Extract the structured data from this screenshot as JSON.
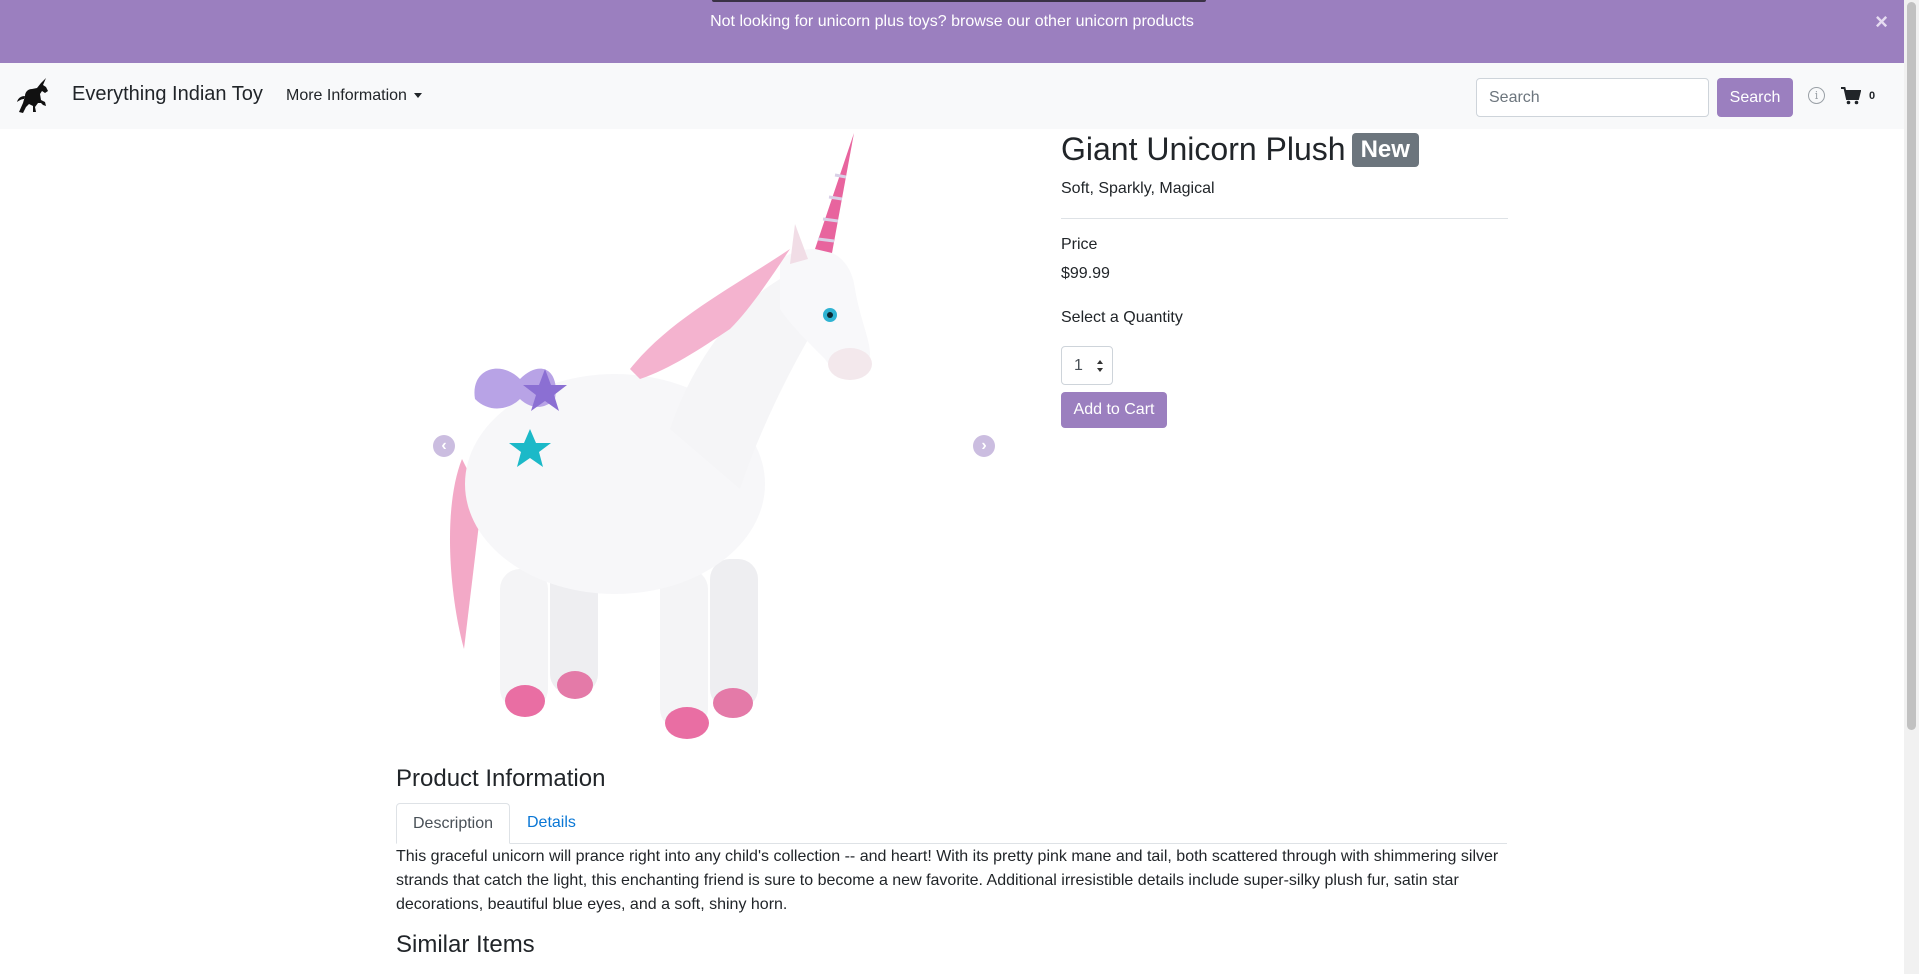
{
  "promo": {
    "text": "Not looking for unicorn plus toys? browse our other unicorn products",
    "close_label": "×"
  },
  "navbar": {
    "brand_name": "Everything Indian Toy",
    "logo_icon": "unicorn-silhouette-icon",
    "more_info_label": "More Information",
    "search_placeholder": "Search",
    "search_button_label": "Search",
    "info_icon": "info-circle-icon",
    "cart_icon": "shopping-cart-icon",
    "cart_count": "0"
  },
  "carousel": {
    "image": "giant-unicorn-plush-photo",
    "prev_label": "‹",
    "next_label": "›"
  },
  "product": {
    "title": "Giant Unicorn Plush",
    "badge": "New",
    "subtitle": "Soft, Sparkly, Magical",
    "price_label": "Price",
    "price": "$99.99",
    "quantity_label": "Select a Quantity",
    "quantity_value": "1",
    "add_to_cart_label": "Add to Cart"
  },
  "info": {
    "heading": "Product Information",
    "tabs": [
      {
        "label": "Description",
        "active": true
      },
      {
        "label": "Details",
        "active": false
      }
    ],
    "description": "This graceful unicorn will prance right into any child's collection -- and heart! With its pretty pink mane and tail, both scattered through with shimmering silver strands that catch the light, this enchanting friend is sure to become a new favorite. Additional irresistible details include super-silky plush fur, satin star decorations, beautiful blue eyes, and a soft, shiny horn."
  },
  "similar": {
    "heading": "Similar Items"
  },
  "colors": {
    "accent": "#9b7fbf",
    "navbar_bg": "#f8f9fa",
    "badge_bg": "#6c757d",
    "link": "#0a77d5"
  }
}
